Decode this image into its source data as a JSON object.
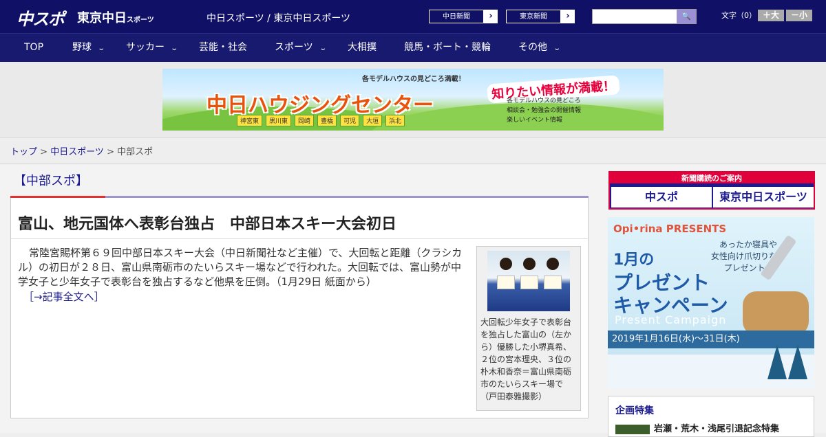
{
  "header": {
    "logo_main": "中スポ",
    "logo_tokyo": "東京中日",
    "logo_tokyo_small": "スポーツ",
    "papers_text": "中日スポーツ / 東京中日スポーツ",
    "btn_chunichi": "中日新聞",
    "btn_tokyo": "東京新聞",
    "arrow": "›",
    "search_placeholder": "",
    "search_icon": "🔍",
    "font_size_label": "文字（0）",
    "font_plus": "＋大",
    "font_minus": "－小"
  },
  "nav": {
    "items": [
      {
        "label": "TOP"
      },
      {
        "label": "野球"
      },
      {
        "label": "サッカー"
      },
      {
        "label": "芸能・社会"
      },
      {
        "label": "スポーツ"
      },
      {
        "label": "大相撲"
      },
      {
        "label": "競馬・ボート・競輪"
      },
      {
        "label": "その他"
      }
    ],
    "chevron": "⌄"
  },
  "banner": {
    "top_text": "各モデルハウスの見どころ満載！",
    "headline": "中日ハウジングセンター",
    "right_badge": "知りたい情報が満載！",
    "list1": "各モデルハウスの見どころ",
    "list2": "相談会・勉強会の開催情報",
    "list3": "楽しいイベント情報",
    "cities": [
      "神宮東",
      "黒川東",
      "岡崎",
      "豊橋",
      "可児",
      "大垣",
      "浜北"
    ]
  },
  "breadcrumb": {
    "top": "トップ",
    "sep": " > ",
    "chunichi": "中日スポーツ",
    "current": "中部スポ"
  },
  "section": {
    "title": "【中部スポ】"
  },
  "article": {
    "headline": "富山、地元国体へ表彰台独占　中部日本スキー大会初日",
    "body": "常陸宮賜杯第６９回中部日本スキー大会（中日新聞社など主催）で、大回転と距離（クラシカル）の初日が２８日、富山県南砺市のたいらスキー場などで行われた。大回転では、富山勢が中学女子と少年女子で表彰台を独占するなど他県を圧倒。（1月29日 紙面から）",
    "more": "［→記事全文へ］",
    "caption": "大回転少年女子で表彰台を独占した富山の（左から）優勝した小堺真希、２位の宮本理央、３位の朴木和香奈＝富山県南砺市のたいらスキー場で（戸田泰雅撮影）"
  },
  "sidebar": {
    "subscribe_title": "新聞購読のご案内",
    "subscribe_chuspo": "中スポ",
    "subscribe_tokyo": "東京中日スポーツ",
    "ad_brand": "Opi•rina PRESENTS",
    "ad_tagline": "あったか寝具や\n女性向け爪切りなど\nプレゼント★",
    "ad_month": "1月の",
    "ad_big1": "プレゼント",
    "ad_big2": "キャンペーン",
    "ad_present": "Present Campaign",
    "ad_date": "2019年1月16日(水)〜31日(木)",
    "feature_title": "企画特集",
    "feature_item": "岩瀬・荒木・浅尾引退記念特集"
  }
}
